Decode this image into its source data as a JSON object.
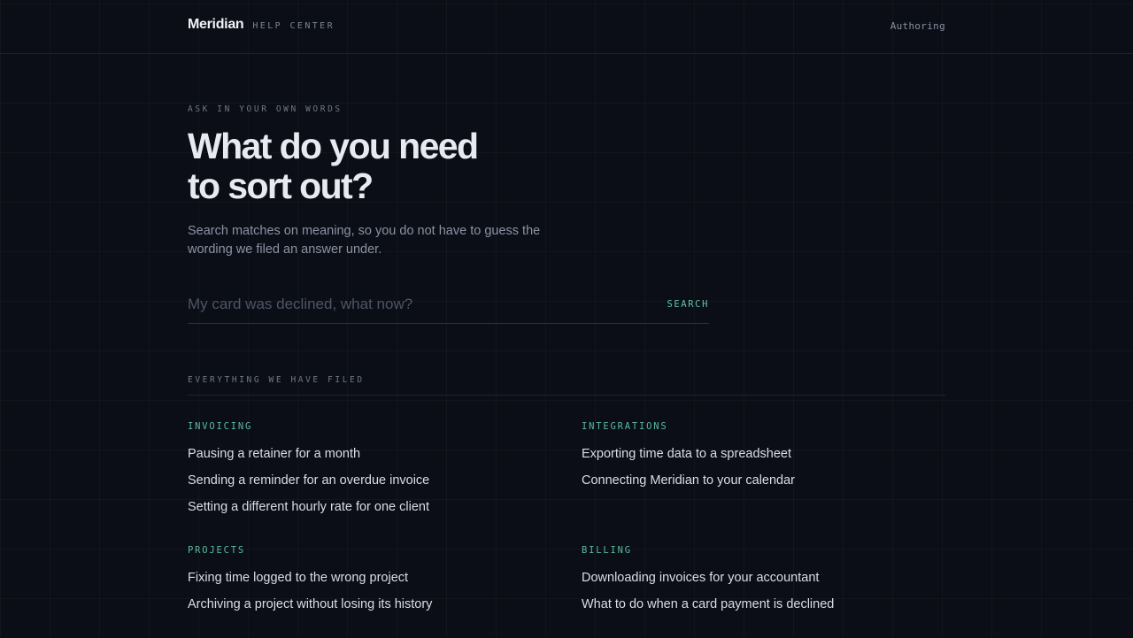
{
  "header": {
    "brand": "Meridian",
    "brand_sub": "HELP CENTER",
    "nav_authoring": "Authoring"
  },
  "hero": {
    "eyebrow": "ASK IN YOUR OWN WORDS",
    "headline_line1": "What do you need",
    "headline_line2": "to sort out?",
    "lede": "Search matches on meaning, so you do not have to guess the wording we filed an answer under."
  },
  "search": {
    "placeholder": "My card was declined, what now?",
    "value": "",
    "button_label": "SEARCH"
  },
  "filed": {
    "label": "EVERYTHING WE HAVE FILED",
    "groups": [
      {
        "title": "INVOICING",
        "items": [
          "Pausing a retainer for a month",
          "Sending a reminder for an overdue invoice",
          "Setting a different hourly rate for one client"
        ]
      },
      {
        "title": "INTEGRATIONS",
        "items": [
          "Exporting time data to a spreadsheet",
          "Connecting Meridian to your calendar"
        ]
      },
      {
        "title": "PROJECTS",
        "items": [
          "Fixing time logged to the wrong project",
          "Archiving a project without losing its history"
        ]
      },
      {
        "title": "BILLING",
        "items": [
          "Downloading invoices for your accountant",
          "What to do when a card payment is declined"
        ]
      }
    ]
  },
  "colors": {
    "background": "#0b0e16",
    "accent": "#5fc2aa",
    "heading": "#e8eaf2",
    "muted": "#8d92a4"
  }
}
